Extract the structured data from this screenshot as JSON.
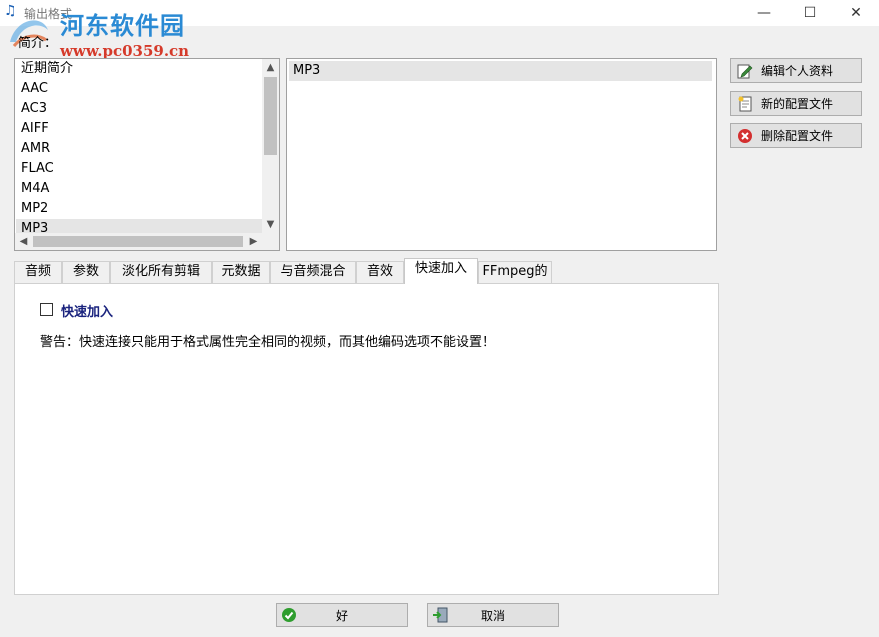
{
  "window": {
    "title": "输出格式",
    "minimize": "—",
    "maximize": "☐",
    "close": "✕"
  },
  "watermark": {
    "logo": "河东软件园",
    "url": "www.pc0359.cn"
  },
  "profile": {
    "label": "简介：",
    "items": [
      "近期简介",
      "AAC",
      "AC3",
      "AIFF",
      "AMR",
      "FLAC",
      "M4A",
      "MP2",
      "MP3"
    ],
    "selected": "MP3"
  },
  "formats": {
    "items": [
      "MP3"
    ]
  },
  "right_buttons": {
    "edit": "编辑个人资料",
    "new": "新的配置文件",
    "delete": "删除配置文件"
  },
  "tabs": [
    {
      "label": "音频"
    },
    {
      "label": "参数"
    },
    {
      "label": "淡化所有剪辑"
    },
    {
      "label": "元数据"
    },
    {
      "label": "与音频混合"
    },
    {
      "label": "音效"
    },
    {
      "label": "快速加入"
    },
    {
      "label": "FFmpeg的"
    }
  ],
  "active_tab": "快速加入",
  "quick_join": {
    "checkbox_label": "快速加入",
    "checked": false,
    "warning": "警告：快速连接只能用于格式属性完全相同的视频，而其他编码选项不能设置！"
  },
  "bottom_buttons": {
    "ok": "好",
    "cancel": "取消"
  },
  "colors": {
    "accent_blue": "#1a237e",
    "ok_green": "#2e9d2e",
    "delete_red": "#d32f2f"
  }
}
